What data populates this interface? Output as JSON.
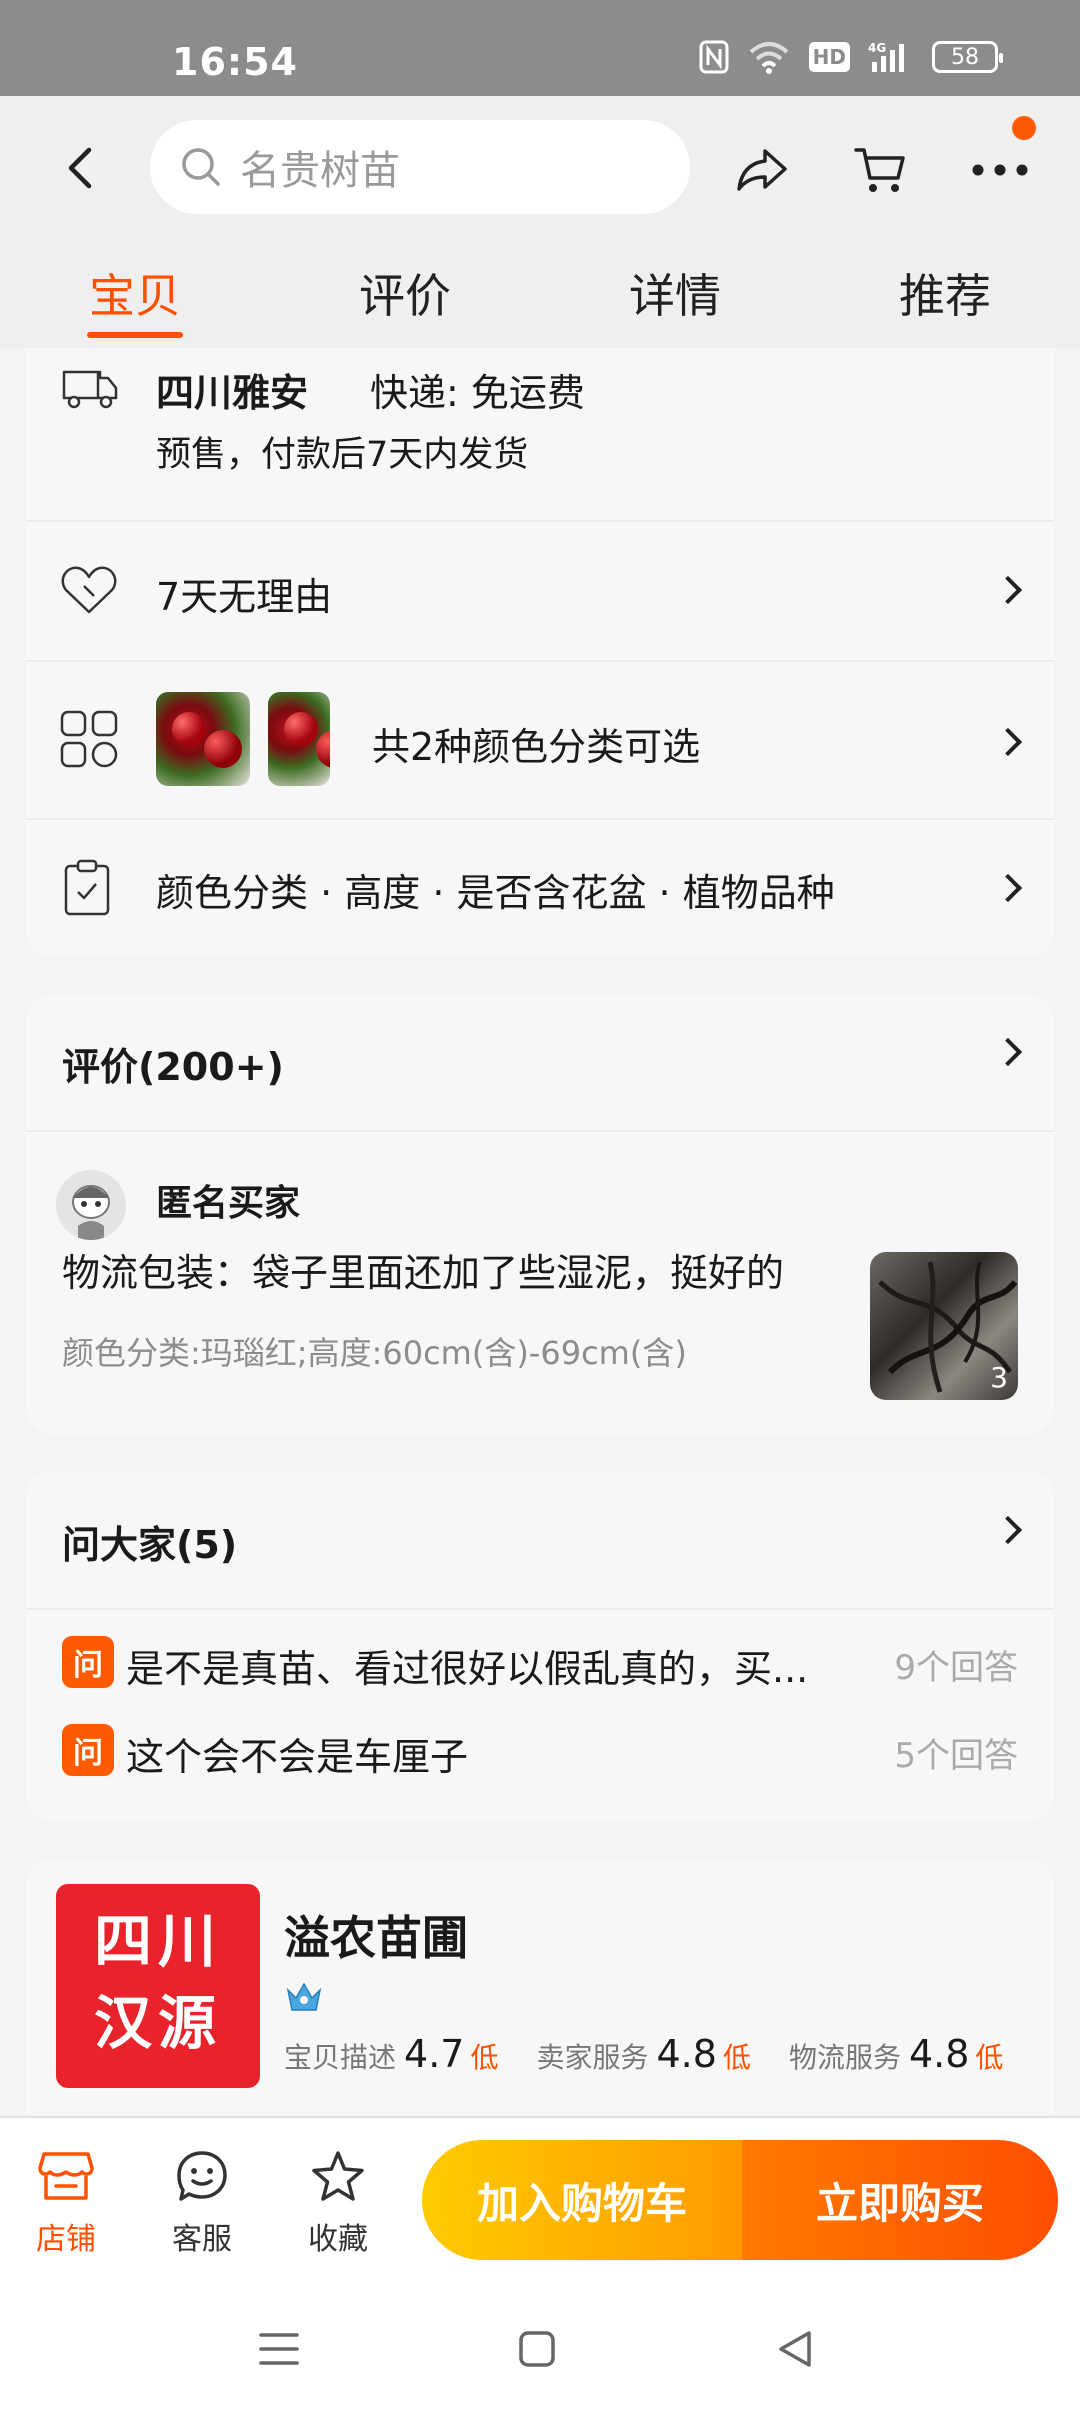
{
  "status_bar": {
    "time": "16:54",
    "battery": "58",
    "network": "4G",
    "hd": "HD"
  },
  "header": {
    "search_placeholder": "名贵树苗",
    "tabs": [
      {
        "label": "宝贝",
        "active": true
      },
      {
        "label": "评价",
        "active": false
      },
      {
        "label": "详情",
        "active": false
      },
      {
        "label": "推荐",
        "active": false
      }
    ]
  },
  "shipping": {
    "origin": "四川雅安",
    "express": "快递: 免运费",
    "note": "预售，付款后7天内发货"
  },
  "guarantee": {
    "label": "7天无理由"
  },
  "variants": {
    "label": "共2种颜色分类可选"
  },
  "specs": {
    "label": "颜色分类 · 高度 · 是否含花盆 · 植物品种"
  },
  "reviews": {
    "title": "评价(200+)",
    "reviewer": "匿名买家",
    "content": "物流包装：袋子里面还加了些湿泥，挺好的",
    "sku": "颜色分类:玛瑙红;高度:60cm(含)-69cm(含)",
    "image_count": "3"
  },
  "qa": {
    "title": "问大家(5)",
    "badge": "问",
    "items": [
      {
        "question": "是不是真苗、看过很好以假乱真的，买...",
        "answers": "9个回答"
      },
      {
        "question": "这个会不会是车厘子",
        "answers": "5个回答"
      }
    ]
  },
  "shop": {
    "logo_line1": "四川",
    "logo_line2": "汉源",
    "name": "溢农苗圃",
    "ratings": [
      {
        "label": "宝贝描述",
        "value": "4.7",
        "level": "低"
      },
      {
        "label": "卖家服务",
        "value": "4.8",
        "level": "低"
      },
      {
        "label": "物流服务",
        "value": "4.8",
        "level": "低"
      }
    ]
  },
  "action_bar": {
    "store": "店铺",
    "service": "客服",
    "favorite": "收藏",
    "add_to_cart": "加入购物车",
    "buy_now": "立即购买"
  },
  "colors": {
    "accent": "#ff5000",
    "cart_gradient": [
      "#ffcb00",
      "#ff9a00"
    ],
    "buy_gradient": [
      "#ff7a00",
      "#ff4e00"
    ]
  }
}
